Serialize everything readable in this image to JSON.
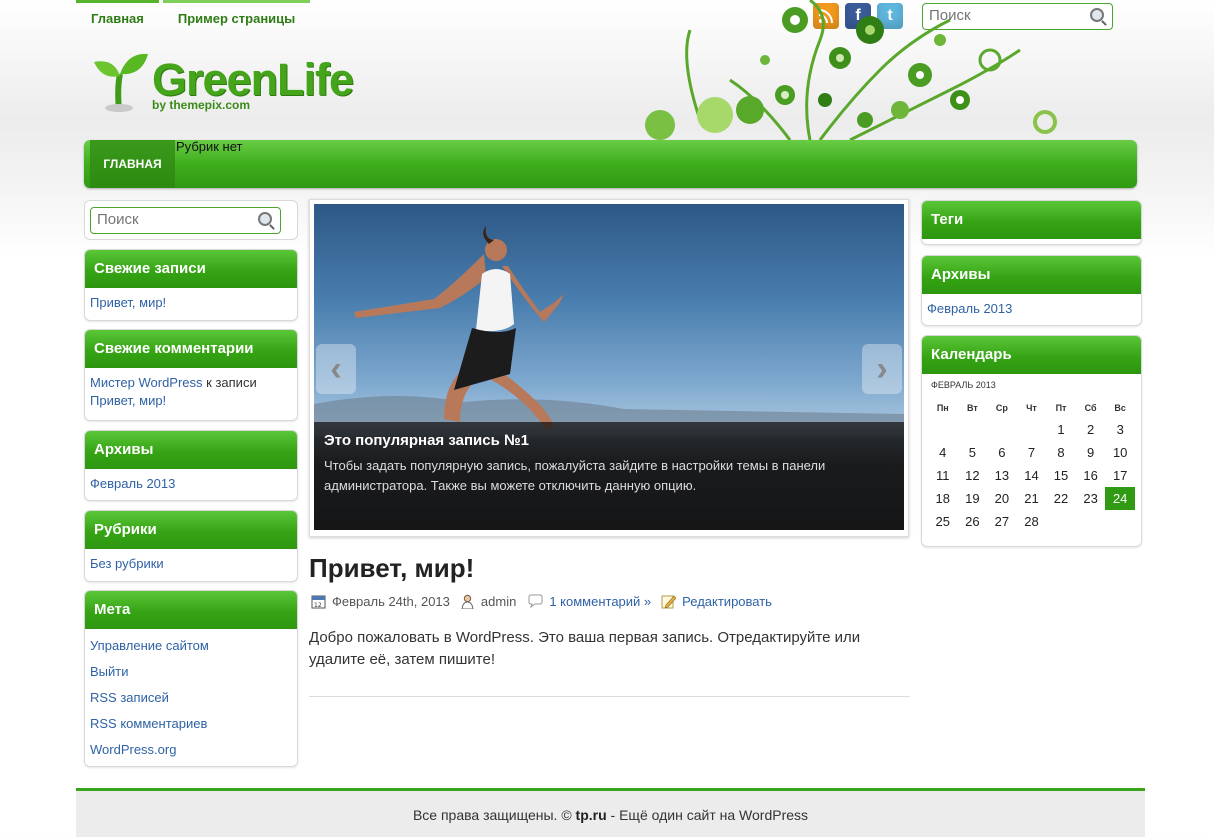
{
  "top_nav": [
    "Главная",
    "Пример страницы"
  ],
  "social": {
    "rss": "RSS",
    "facebook": "f",
    "twitter": "t"
  },
  "top_search": {
    "placeholder": "Поиск"
  },
  "logo": {
    "title": "GreenLife",
    "by": "by themepix.com"
  },
  "main_nav": {
    "home": "ГЛАВНАЯ",
    "no_categories": "Рубрик нет"
  },
  "sidebar_left": {
    "search_placeholder": "Поиск",
    "recent_posts": {
      "title": "Свежие записи",
      "items": [
        "Привет, мир!"
      ]
    },
    "recent_comments": {
      "title": "Свежие комментарии",
      "author": "Мистер WordPress",
      "connector": "к записи",
      "post": "Привет, мир!"
    },
    "archives": {
      "title": "Архивы",
      "items": [
        "Февраль 2013"
      ]
    },
    "categories": {
      "title": "Рубрики",
      "items": [
        "Без рубрики"
      ]
    },
    "meta": {
      "title": "Мета",
      "items": [
        "Управление сайтом",
        "Выйти",
        "RSS записей",
        "RSS комментариев",
        "WordPress.org"
      ]
    }
  },
  "slider": {
    "title": "Это популярная запись №1",
    "text": "Чтобы задать популярную запись, пожалуйста зайдите в настройки темы в панели администратора. Также вы можете отключить данную опцию.",
    "prev": "‹",
    "next": "›"
  },
  "post": {
    "title": "Привет, мир!",
    "date": "Февраль 24th, 2013",
    "author": "admin",
    "comments": "1 комментарий »",
    "edit": "Редактировать",
    "body": "Добро пожаловать в WordPress. Это ваша первая запись. Отредактируйте или удалите её, затем пишите!"
  },
  "sidebar_right": {
    "tags": {
      "title": "Теги"
    },
    "archives": {
      "title": "Архивы",
      "items": [
        "Февраль 2013"
      ]
    },
    "calendar": {
      "title": "Календарь",
      "caption": "ФЕВРАЛЬ 2013",
      "weekdays": [
        "Пн",
        "Вт",
        "Ср",
        "Чт",
        "Пт",
        "Сб",
        "Вс"
      ],
      "weeks": [
        [
          "",
          "",
          "",
          "",
          "1",
          "2",
          "3"
        ],
        [
          "4",
          "5",
          "6",
          "7",
          "8",
          "9",
          "10"
        ],
        [
          "11",
          "12",
          "13",
          "14",
          "15",
          "16",
          "17"
        ],
        [
          "18",
          "19",
          "20",
          "21",
          "22",
          "23",
          "24"
        ],
        [
          "25",
          "26",
          "27",
          "28",
          "",
          "",
          ""
        ]
      ],
      "today": "24"
    }
  },
  "footer": {
    "prefix": "Все права защищены. ©",
    "site": "tp.ru",
    "suffix": "- Ещё один сайт на WordPress"
  },
  "colors": {
    "accent_green": "#3fae1d",
    "link_blue": "#2f62a5"
  }
}
